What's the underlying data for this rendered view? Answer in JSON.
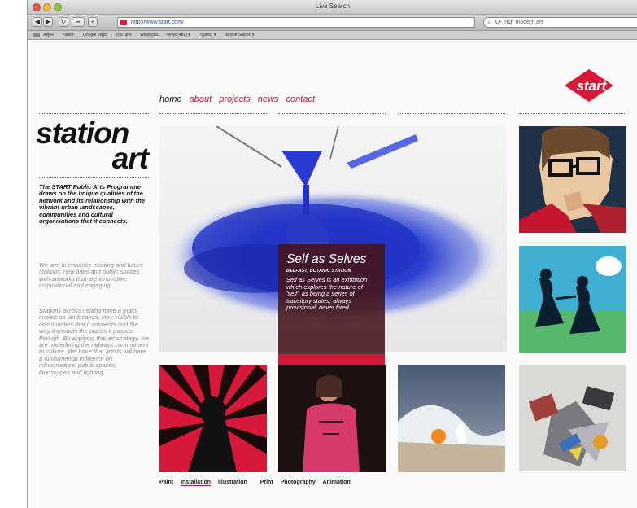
{
  "browser": {
    "title": "Live Search",
    "url": "http://www.start.com/",
    "search_value": "Q- irish modern art",
    "bookmarks": [
      "Apple",
      "Yahoo!",
      "Google Maps",
      "YouTube",
      "Wikipedia",
      "News (481) ▾",
      "Popular ▾",
      "Bicycle Station ▾"
    ]
  },
  "logo": {
    "text": "start",
    "color": "#d6193a"
  },
  "nav": [
    {
      "label": "home",
      "active": true
    },
    {
      "label": "about",
      "active": false
    },
    {
      "label": "projects",
      "active": false
    },
    {
      "label": "news",
      "active": false
    },
    {
      "label": "contact",
      "active": false
    }
  ],
  "sidebar": {
    "headline_line1": "station",
    "headline_line2": "art",
    "intro": "The START Public Arts Programme draws on the unique qualities of the network and its relationship with the vibrant urban landscapes, communities and cultural organisations that it connects.",
    "para1": "We aim to enhance existing and future stations, new lines and public spaces with artworks that are innovative, inspirational and engaging.",
    "para2": "Stations across Ireland have a major impact on landscapes, very visible to communities that it connects and the way it impacts the places it passes through. By applying this art strategy, we are underlining the railways commitment to culture. We hope that artists will have a fundamental influence on infrastructure, public spaces, landscapes and lighting."
  },
  "feature": {
    "title": "Self as Selves",
    "location": "BELFAST, BOTANIC STATION",
    "description": "Self as Selves is an exhibition which explores the nature of 'self', as being a series of transitory states, always provisional, never fixed."
  },
  "categories": [
    {
      "label": "Paint",
      "selected": false
    },
    {
      "label": "Installation",
      "selected": true
    },
    {
      "label": "Illustration",
      "selected": false
    },
    {
      "label": "Print",
      "selected": false
    },
    {
      "label": "Photography",
      "selected": false
    },
    {
      "label": "Animation",
      "selected": false
    }
  ],
  "colors": {
    "accent": "#c4162f",
    "caption_bg": "#461419",
    "blue_pigment": "#2a3fd0"
  }
}
